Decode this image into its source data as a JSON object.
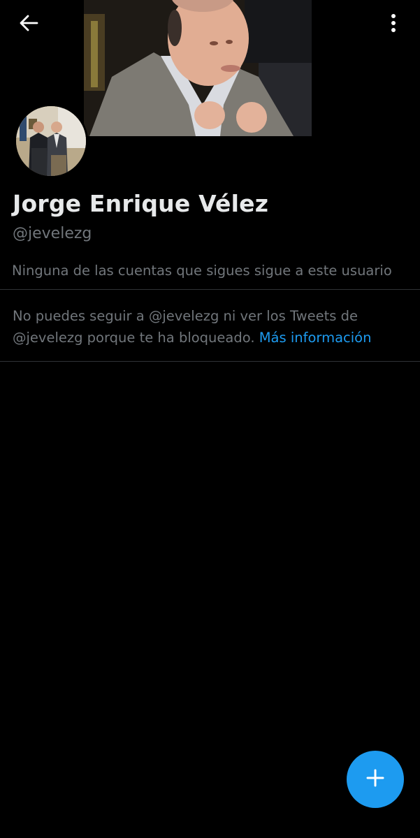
{
  "profile": {
    "display_name": "Jorge Enrique Vélez",
    "handle": "@jevelezg",
    "followers_note": "Ninguna de las cuentas que sigues sigue a este usuario"
  },
  "blocked_notice": {
    "text": "No puedes seguir a @jevelezg ni ver los Tweets de @jevelezg porque te ha bloqueado.",
    "link_label": "Más información"
  },
  "icons": {
    "back": "back-arrow-icon",
    "more": "more-vertical-icon",
    "compose": "plus-icon"
  },
  "colors": {
    "background": "#000000",
    "accent": "#1d9bf0",
    "primary_text": "#e7e9ea",
    "secondary_text": "#71767b",
    "divider": "#2f3336"
  }
}
